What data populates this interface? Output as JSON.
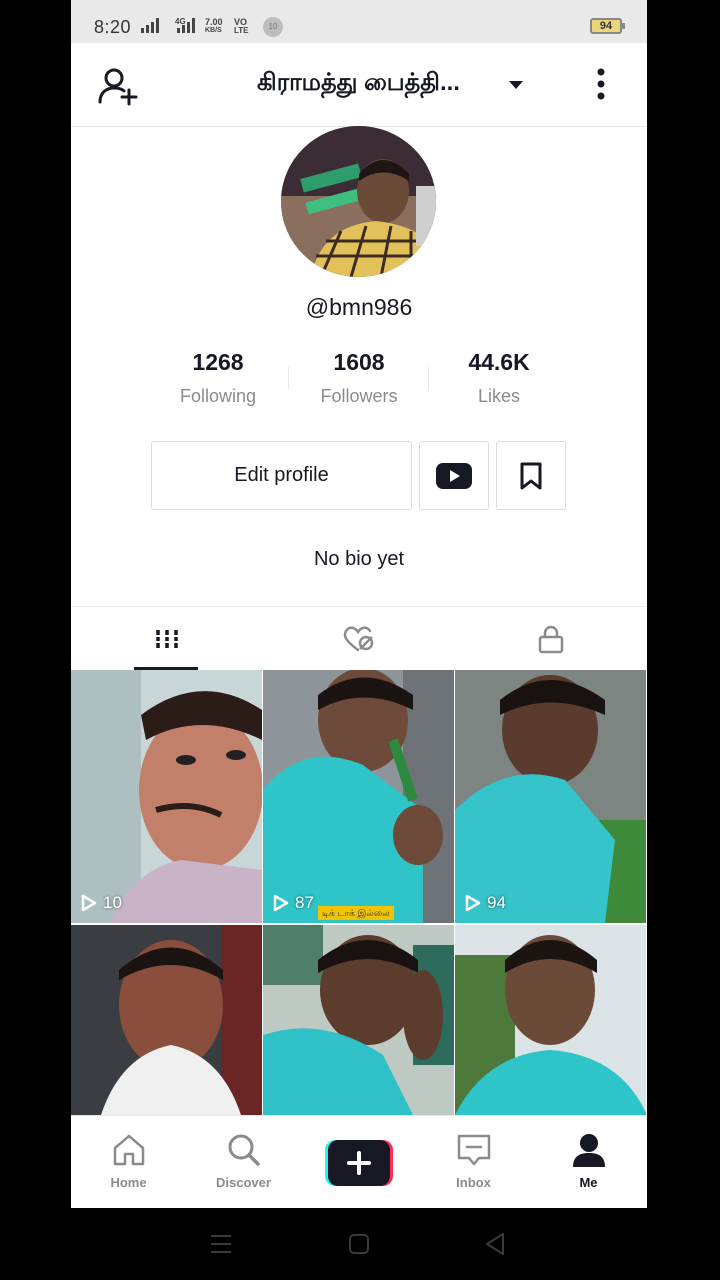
{
  "status_bar": {
    "time": "8:20",
    "network_label": "4G",
    "speed_value": "7.00",
    "speed_unit": "KB/S",
    "volte_top": "VO",
    "volte_bottom": "LTE",
    "notification_count": "10",
    "battery": "94"
  },
  "header": {
    "title": "கிராமத்து பைத்தி...",
    "add_user_icon": "add-user-icon",
    "more_icon": "more-vertical-icon"
  },
  "profile": {
    "username": "@bmn986",
    "stats": [
      {
        "value": "1268",
        "label": "Following"
      },
      {
        "value": "1608",
        "label": "Followers"
      },
      {
        "value": "44.6K",
        "label": "Likes"
      }
    ],
    "edit_label": "Edit profile",
    "bio": "No bio yet"
  },
  "tabs": [
    {
      "name": "videos",
      "icon": "grid-icon",
      "active": true
    },
    {
      "name": "liked",
      "icon": "heart-hidden-icon",
      "active": false
    },
    {
      "name": "private",
      "icon": "lock-icon",
      "active": false
    }
  ],
  "videos": [
    {
      "views": "10"
    },
    {
      "views": "87",
      "caption": "டிக் டாக் இல்லை"
    },
    {
      "views": "94"
    },
    {
      "views": ""
    },
    {
      "views": ""
    },
    {
      "views": ""
    }
  ],
  "bottom_nav": {
    "items": [
      {
        "label": "Home",
        "icon": "home-icon"
      },
      {
        "label": "Discover",
        "icon": "search-icon"
      },
      {
        "label": "",
        "icon": "plus-icon"
      },
      {
        "label": "Inbox",
        "icon": "inbox-icon"
      },
      {
        "label": "Me",
        "icon": "profile-icon"
      }
    ]
  },
  "colors": {
    "text_primary": "#161823",
    "text_secondary": "#8a8b91",
    "plus_cyan": "#25f4ee",
    "plus_red": "#fe2c55"
  }
}
